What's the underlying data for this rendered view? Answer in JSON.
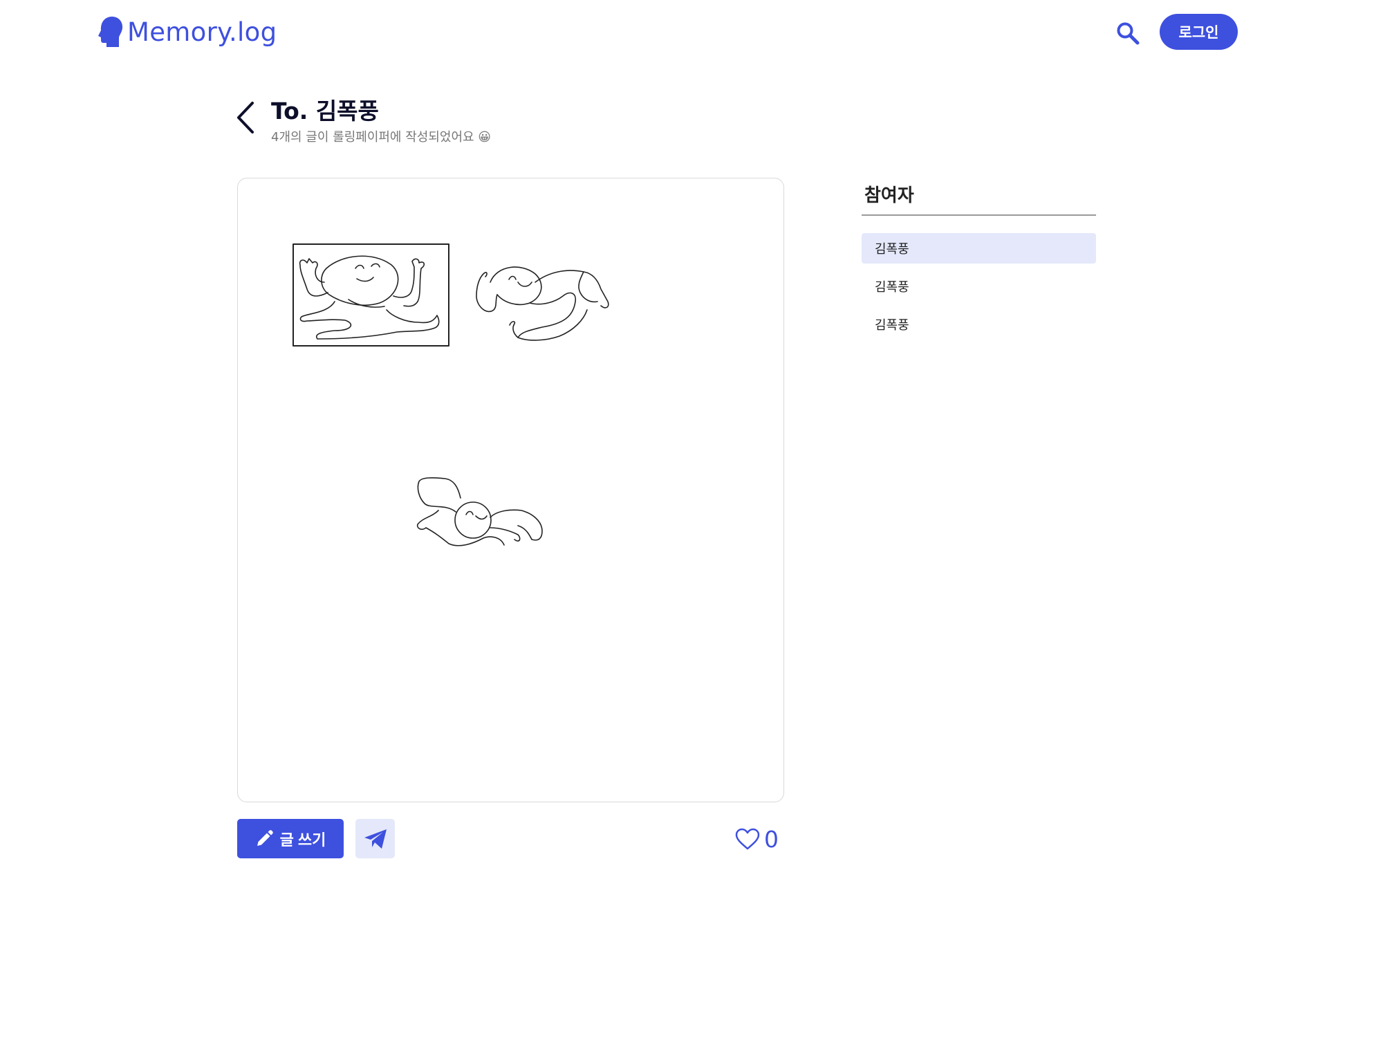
{
  "header": {
    "logo_text": "Memory.log",
    "logo_icon": "head-silhouette-icon",
    "search_icon": "search-icon",
    "login_label": "로그인"
  },
  "page": {
    "title": "To. 김폭풍",
    "subtitle": "4개의 글이 롤링페이퍼에 작성되었어요 😀",
    "back_icon": "chevron-left-icon"
  },
  "board": {
    "drawings": [
      "doodle-figure-framed",
      "doodle-figure-swirl",
      "doodle-figure-running"
    ]
  },
  "actions": {
    "write_label": "글 쓰기",
    "write_icon": "pencil-icon",
    "send_icon": "paper-plane-icon",
    "like_icon": "heart-outline-icon",
    "like_count": "0"
  },
  "participants": {
    "heading": "참여자",
    "items": [
      {
        "name": "김폭풍",
        "active": true
      },
      {
        "name": "김폭풍",
        "active": false
      },
      {
        "name": "김폭풍",
        "active": false
      }
    ]
  },
  "colors": {
    "primary": "#3E50DE",
    "primary_light": "#E4E8FA",
    "title": "#0d0f2a",
    "subtitle": "#777777"
  }
}
